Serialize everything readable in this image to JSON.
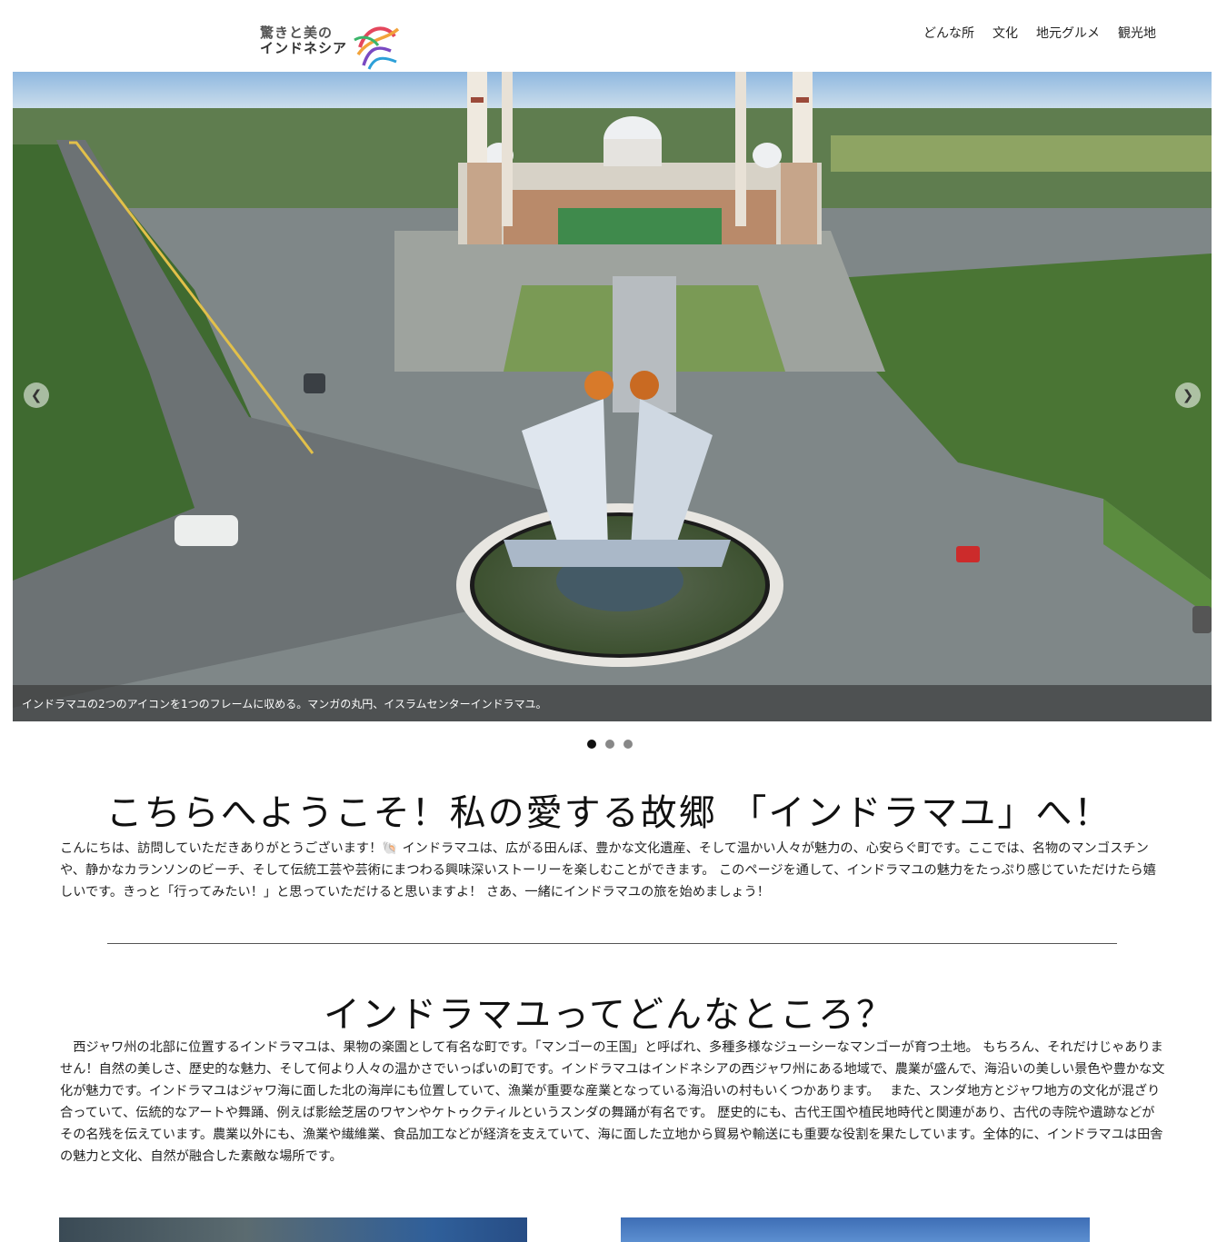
{
  "header": {
    "logo_line1": "驚きと美の",
    "logo_line2": "インドネシア",
    "nav": [
      {
        "label": "どんな所"
      },
      {
        "label": "文化"
      },
      {
        "label": "地元グルメ"
      },
      {
        "label": "観光地"
      }
    ]
  },
  "carousel": {
    "caption": "インドラマユの2つのアイコンを1つのフレームに収める。マンガの丸円、イスラムセンターインドラマユ。",
    "prev_icon": "chevron-left-icon",
    "next_icon": "chevron-right-icon",
    "slide_count": 3,
    "active_slide": 1,
    "prev_glyph": "❮",
    "next_glyph": "❯"
  },
  "welcome": {
    "title": "こちらへようこそ！私の愛する故郷 「インドラマユ」へ！",
    "text": "こんにちは、訪問していただきありがとうございます！🐚 インドラマユは、広がる田んぼ、豊かな文化遺産、そして温かい人々が魅力の、心安らぐ町です。ここでは、名物のマンゴスチンや、静かなカランソンのビーチ、そして伝統工芸や芸術にまつわる興味深いストーリーを楽しむことができます。 このページを通して、インドラマユの魅力をたっぷり感じていただけたら嬉しいです。きっと「行ってみたい！」と思っていただけると思いますよ！ さあ、一緒にインドラマユの旅を始めましょう！"
  },
  "about": {
    "title": "インドラマユってどんなところ？",
    "text": "　西ジャワ州の北部に位置するインドラマユは、果物の楽園として有名な町です。「マンゴーの王国」と呼ばれ、多種多様なジューシーなマンゴーが育つ土地。 もちろん、それだけじゃありません！自然の美しさ、歴史的な魅力、そして何より人々の温かさでいっぱいの町です。インドラマユはインドネシアの西ジャワ州にある地域で、農業が盛んで、海沿いの美しい景色や豊かな文化が魅力です。インドラマユはジャワ海に面した北の海岸にも位置していて、漁業が重要な産業となっている海沿いの村もいくつかあります。　 また、スンダ地方とジャワ地方の文化が混ざり合っていて、伝統的なアートや舞踊、例えば影絵芝居のワヤンやケトゥクティルというスンダの舞踊が有名です。 歴史的にも、古代王国や植民地時代と関連があり、古代の寺院や遺跡などがその名残を伝えています。農業以外にも、漁業や繊維業、食品加工などが経済を支えていて、海に面した立地から貿易や輸送にも重要な役割を果たしています。全体的に、インドラマユは田舎の魅力と文化、自然が融合した素敵な場所です。"
  }
}
